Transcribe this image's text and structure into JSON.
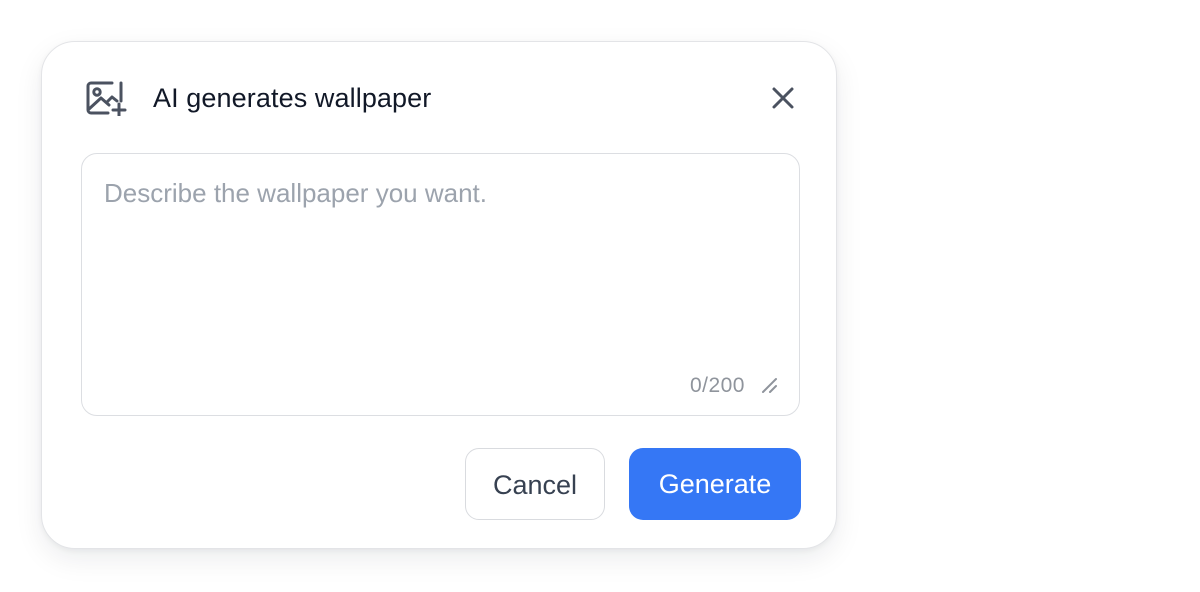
{
  "dialog": {
    "title": "AI generates wallpaper",
    "header_icon": "image-add-icon",
    "close_icon": "close-icon"
  },
  "prompt": {
    "value": "",
    "placeholder": "Describe the wallpaper you want.",
    "counter": "0/200",
    "resize_icon": "resize-handle-icon"
  },
  "actions": {
    "cancel_label": "Cancel",
    "generate_label": "Generate"
  },
  "colors": {
    "primary": "#3577f5",
    "title_text": "#111827",
    "placeholder_text": "#9ca3ad",
    "icon": "#4b5260",
    "border": "#e3e4e7"
  }
}
